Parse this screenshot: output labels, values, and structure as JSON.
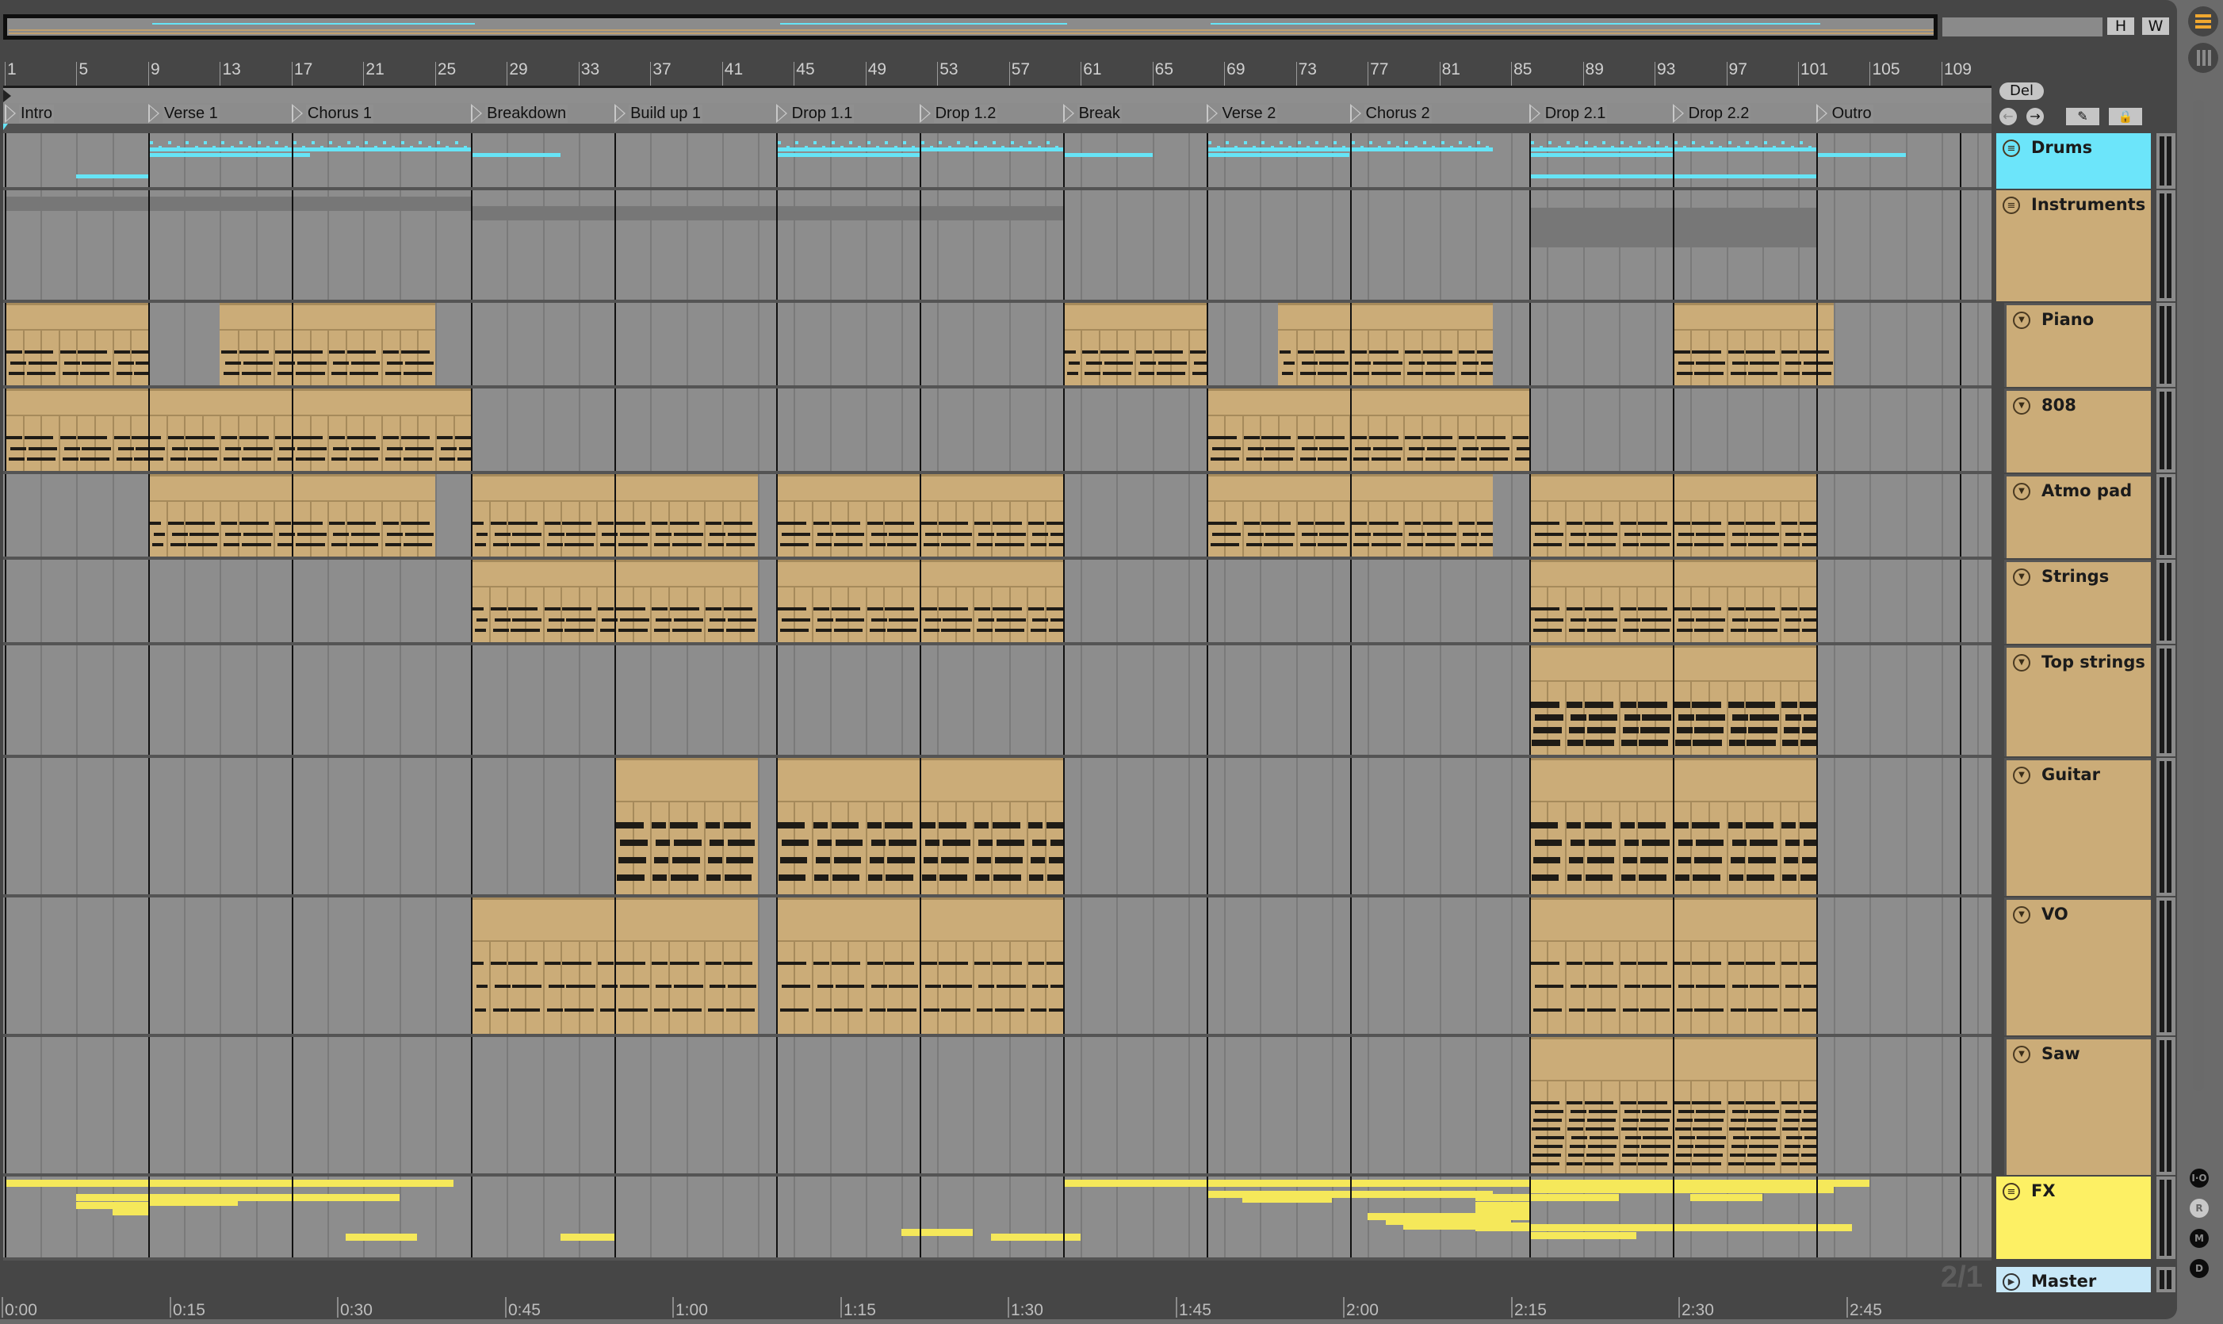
{
  "window": {
    "overview_buttons": {
      "h": "H",
      "w": "W"
    },
    "side_buttons": [
      {
        "name": "arrangement-view",
        "icon": "hamburger-icon",
        "active": true,
        "color": "#f0a830"
      },
      {
        "name": "session-view",
        "icon": "columns-icon",
        "active": false
      }
    ]
  },
  "ruler": {
    "bars": [
      "1",
      "5",
      "9",
      "13",
      "17",
      "21",
      "25",
      "29",
      "33",
      "37",
      "41",
      "45",
      "49",
      "53",
      "57",
      "61",
      "65",
      "69",
      "73",
      "77",
      "81",
      "85",
      "89",
      "93",
      "97",
      "101",
      "105",
      "109"
    ],
    "times": [
      "0:00",
      "0:15",
      "0:30",
      "0:45",
      "1:00",
      "1:15",
      "1:30",
      "1:45",
      "2:00",
      "2:15",
      "2:30",
      "2:45"
    ],
    "time_signature": "2/1"
  },
  "locators": [
    {
      "name": "Intro",
      "bar": 1
    },
    {
      "name": "Verse 1",
      "bar": 9
    },
    {
      "name": "Chorus 1",
      "bar": 17
    },
    {
      "name": "Breakdown",
      "bar": 27
    },
    {
      "name": "Build up 1",
      "bar": 35
    },
    {
      "name": "Drop 1.1",
      "bar": 44
    },
    {
      "name": "Drop 1.2",
      "bar": 52
    },
    {
      "name": "Break",
      "bar": 60
    },
    {
      "name": "Verse 2",
      "bar": 68
    },
    {
      "name": "Chorus 2",
      "bar": 76
    },
    {
      "name": "Drop 2.1",
      "bar": 86
    },
    {
      "name": "Drop 2.2",
      "bar": 94
    },
    {
      "name": "Outro",
      "bar": 102
    }
  ],
  "controls": {
    "delete_label": "Del",
    "prev_icon": "arrow-left-icon",
    "next_icon": "arrow-right-icon",
    "draw_icon": "pencil-icon",
    "lock_icon": "lock-icon"
  },
  "tracks": [
    {
      "name": "Drums",
      "type": "group",
      "color": "#6ce5fa",
      "icon": "group-fold-icon"
    },
    {
      "name": "Instruments",
      "type": "group",
      "color": "#cbac78",
      "icon": "group-fold-icon"
    },
    {
      "name": "Piano",
      "type": "midi",
      "color": "#cbac78",
      "icon": "fold-triangle-icon",
      "clips": [
        [
          1,
          9
        ],
        [
          13,
          25
        ],
        [
          60,
          68
        ],
        [
          72,
          84
        ],
        [
          94,
          103
        ]
      ]
    },
    {
      "name": "808",
      "type": "midi",
      "color": "#cbac78",
      "icon": "fold-triangle-icon",
      "clips": [
        [
          1,
          27
        ],
        [
          68,
          86
        ]
      ]
    },
    {
      "name": "Atmo pad",
      "type": "midi",
      "color": "#cbac78",
      "icon": "fold-triangle-icon",
      "clips": [
        [
          9,
          25
        ],
        [
          27,
          43
        ],
        [
          44,
          60
        ],
        [
          68,
          84
        ],
        [
          86,
          102
        ]
      ]
    },
    {
      "name": "Strings",
      "type": "midi",
      "color": "#cbac78",
      "icon": "fold-triangle-icon",
      "clips": [
        [
          27,
          43
        ],
        [
          44,
          60
        ],
        [
          86,
          102
        ]
      ]
    },
    {
      "name": "Top strings",
      "type": "midi",
      "color": "#cbac78",
      "icon": "fold-triangle-icon",
      "clips": [
        [
          86,
          102
        ]
      ]
    },
    {
      "name": "Guitar",
      "type": "midi",
      "color": "#cbac78",
      "icon": "fold-triangle-icon",
      "clips": [
        [
          35,
          43
        ],
        [
          44,
          60
        ],
        [
          86,
          102
        ]
      ]
    },
    {
      "name": "VO",
      "type": "midi",
      "color": "#cbac78",
      "icon": "fold-triangle-icon",
      "clips": [
        [
          27,
          43
        ],
        [
          44,
          60
        ],
        [
          86,
          102
        ]
      ]
    },
    {
      "name": "Saw",
      "type": "midi",
      "color": "#cbac78",
      "icon": "fold-triangle-icon",
      "clips": [
        [
          86,
          102
        ]
      ]
    },
    {
      "name": "FX",
      "type": "group",
      "color": "#fdf064",
      "icon": "group-fold-icon"
    },
    {
      "name": "Master",
      "type": "master",
      "color": "#c8e8f8",
      "icon": "play-circle-icon"
    }
  ],
  "mixer_toggles": [
    "I·O",
    "R",
    "M",
    "D"
  ]
}
